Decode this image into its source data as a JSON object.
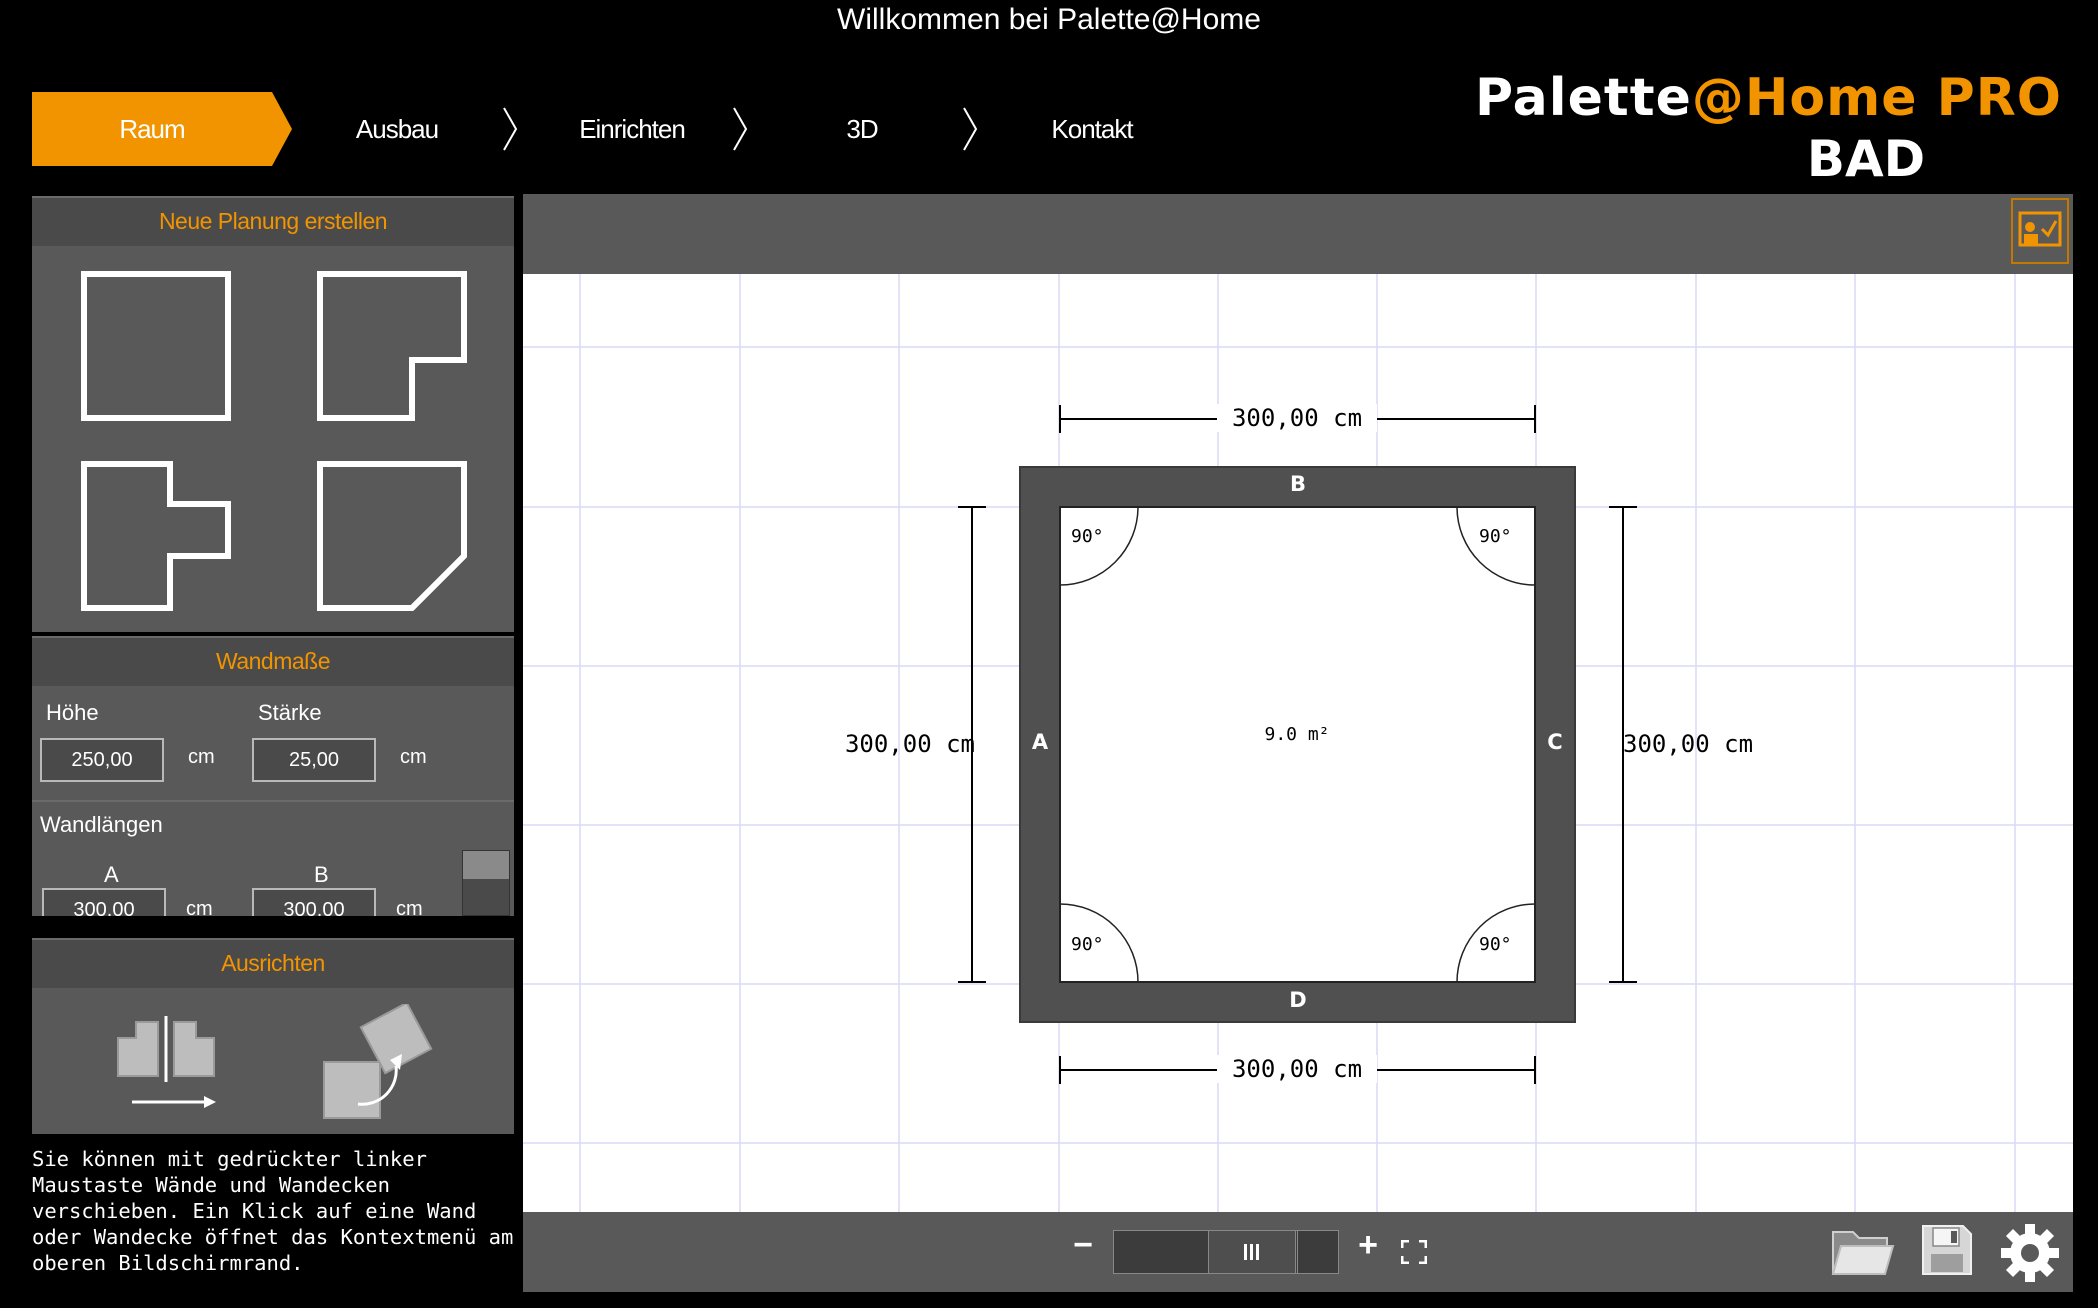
{
  "window_title": "Willkommen bei Palette@Home",
  "nav": {
    "steps": [
      "Raum",
      "Ausbau",
      "Einrichten",
      "3D",
      "Kontakt"
    ],
    "active": "Raum"
  },
  "logo": {
    "line1_white": "Palette",
    "line1_orange": "@Home PRO",
    "line2": "BAD"
  },
  "colors": {
    "accent": "#f29400",
    "panel": "#595959",
    "panel_header": "#4a4a4a",
    "canvas": "#ffffff",
    "grid": "#d8d8f6",
    "wall": "#505050"
  },
  "sidebar": {
    "new_plan_title": "Neue Planung erstellen",
    "room_shapes": [
      "square-room",
      "l-shaped-room",
      "t-shaped-room",
      "chamfered-room"
    ],
    "wall_dims_title": "Wandmaße",
    "height_label": "Höhe",
    "height_value": "250,00",
    "thickness_label": "Stärke",
    "thickness_value": "25,00",
    "unit": "cm",
    "wall_lengths_title": "Wandlängen",
    "wall_a_label": "A",
    "wall_a_value": "300,00",
    "wall_b_label": "B",
    "wall_b_value": "300,00",
    "align_title": "Ausrichten",
    "align_tools": [
      "mirror-icon",
      "rotate-icon"
    ],
    "help_text": "Sie können mit gedrückter linker Maustaste Wände und Wandecken verschieben. Ein Klick auf eine Wand oder Wandecke öffnet das Kontextmenü am oberen Bildschirmrand."
  },
  "plan": {
    "walls": {
      "top": "B",
      "left": "A",
      "right": "C",
      "bottom": "D"
    },
    "dim_top": "300,00 cm",
    "dim_bottom": "300,00 cm",
    "dim_left": "300,00 cm",
    "dim_right": "300,00 cm",
    "area": "9.0 m²",
    "angles": [
      "90°",
      "90°",
      "90°",
      "90°"
    ]
  },
  "bottom_bar": {
    "zoom_out": "−",
    "zoom_in": "+",
    "icons": [
      "folder-icon",
      "save-icon",
      "gear-icon",
      "fit-screen-icon",
      "presentation-icon"
    ]
  }
}
